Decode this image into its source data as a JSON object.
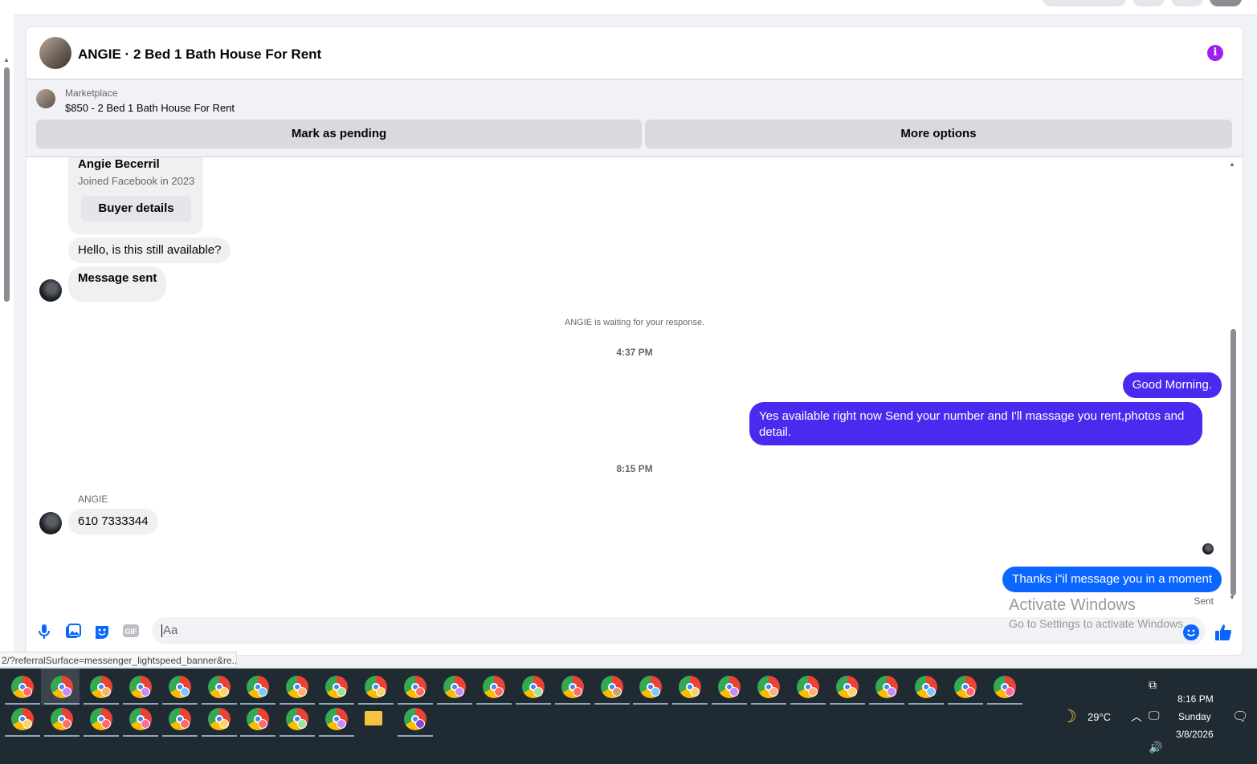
{
  "header": {
    "title": "ANGIE · 2 Bed 1 Bath House For Rent"
  },
  "marketplace": {
    "label": "Marketplace",
    "listing": "$850 - 2 Bed 1 Bath House For Rent",
    "mark_pending": "Mark as pending",
    "more_options": "More options"
  },
  "buyer_card": {
    "name": "Angie Becerril",
    "joined": "Joined Facebook in 2023",
    "button": "Buyer details"
  },
  "messages": {
    "m1": "Hello, is this still available?",
    "m2": "Message sent",
    "waiting": "ANGIE is waiting for your response.",
    "time1": "4:37 PM",
    "m3": "Good Morning.",
    "m4": "Yes available right now Send your number and I'll massage you rent,photos and detail.",
    "time2": "8:15 PM",
    "sender": "ANGIE",
    "m5": "610 7333344",
    "m6": "Thanks i\"il message you in a moment",
    "status": "Sent"
  },
  "composer": {
    "placeholder": "Aa"
  },
  "watermark": {
    "line1": "Activate Windows",
    "line2": "Go to Settings to activate Windows."
  },
  "status_url": "2/?referralSurface=messenger_lightspeed_banner&re...",
  "tray": {
    "weather": "29°C",
    "time": "8:16 PM",
    "day": "Sunday",
    "date": "3/8/2026"
  },
  "colors": {
    "outgoing": "#4b2af0",
    "outgoing_last": "#0a66ff",
    "info": "#a020f0",
    "taskbar": "#1f2a33"
  },
  "taskbar_row1_badges": [
    "#ff6b6b",
    "#c58bff",
    "#f4b860",
    "#c58bff",
    "#7ec8ff",
    "#ffd166",
    "#7ec8ff",
    "#ffb07a",
    "#9be39b",
    "#ffd166",
    "#ff6b6b",
    "#c58bff",
    "#ff6b6b",
    "#9be39b",
    "#ff6b6b",
    "#d0a070",
    "#7ec8ff",
    "#ffd166",
    "#c58bff",
    "#ffb07a",
    "#ffb07a",
    "#ffd166",
    "#c58bff",
    "#7ec8ff",
    "#ff6b6b",
    "#ff6b9e"
  ],
  "taskbar_row2_badges": [
    "#ffd166",
    "#ff6b6b",
    "#ff6b6b",
    "#ff6b9e",
    "#ff6b6b",
    "#ffd166",
    "#ff6b6b",
    "#9be39b",
    "#c58bff"
  ]
}
